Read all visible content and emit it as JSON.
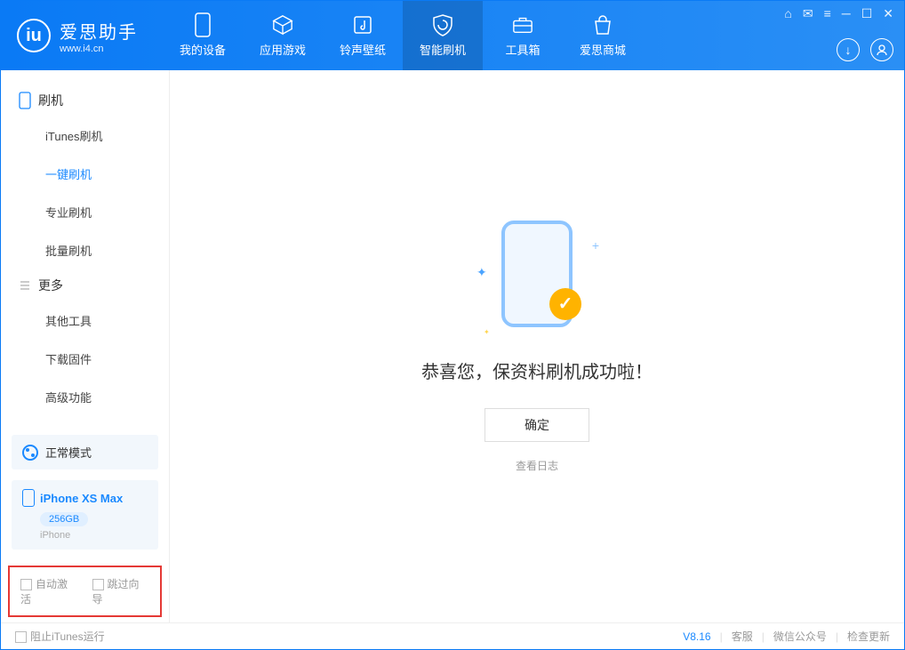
{
  "app": {
    "name_cn": "爱思助手",
    "url": "www.i4.cn"
  },
  "tabs": {
    "my_device": "我的设备",
    "apps_games": "应用游戏",
    "ringtones": "铃声壁纸",
    "flash": "智能刷机",
    "toolbox": "工具箱",
    "store": "爱思商城"
  },
  "sidebar": {
    "group_flash": "刷机",
    "items_flash": {
      "itunes": "iTunes刷机",
      "onekey": "一键刷机",
      "pro": "专业刷机",
      "batch": "批量刷机"
    },
    "group_more": "更多",
    "items_more": {
      "other": "其他工具",
      "firmware": "下载固件",
      "advanced": "高级功能"
    },
    "mode": "正常模式",
    "device_name": "iPhone XS Max",
    "device_storage": "256GB",
    "device_type": "iPhone",
    "opt_auto_activate": "自动激活",
    "opt_skip_guide": "跳过向导"
  },
  "main": {
    "success_title": "恭喜您，保资料刷机成功啦！",
    "ok": "确定",
    "view_log": "查看日志"
  },
  "footer": {
    "block_itunes": "阻止iTunes运行",
    "version": "V8.16",
    "support": "客服",
    "wechat": "微信公众号",
    "update": "检查更新"
  }
}
